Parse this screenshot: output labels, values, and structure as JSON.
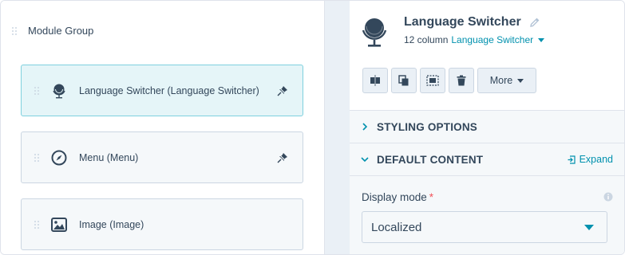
{
  "left_panel": {
    "group_title": "Module Group",
    "modules": [
      {
        "label": "Language Switcher (Language Switcher)",
        "icon": "globe-icon",
        "pinned": true,
        "active": true
      },
      {
        "label": "Menu (Menu)",
        "icon": "compass-icon",
        "pinned": true,
        "active": false
      },
      {
        "label": "Image (Image)",
        "icon": "image-icon",
        "pinned": false,
        "active": false
      }
    ]
  },
  "right_panel": {
    "title": "Language Switcher",
    "subtitle_prefix": "12 column",
    "subtitle_link": "Language Switcher",
    "toolbar": {
      "buttons": [
        "split-icon",
        "copy-icon",
        "select-icon",
        "trash-icon"
      ],
      "more_label": "More"
    },
    "sections": {
      "styling": "STYLING OPTIONS",
      "default_content": "DEFAULT CONTENT",
      "expand_label": "Expand"
    },
    "field": {
      "label": "Display mode",
      "required_mark": "*",
      "value": "Localized"
    }
  },
  "colors": {
    "accent": "#0091ae",
    "active_border": "#7fd1de",
    "active_bg": "#e5f5f8",
    "text": "#33475b",
    "required": "#f2545b"
  }
}
